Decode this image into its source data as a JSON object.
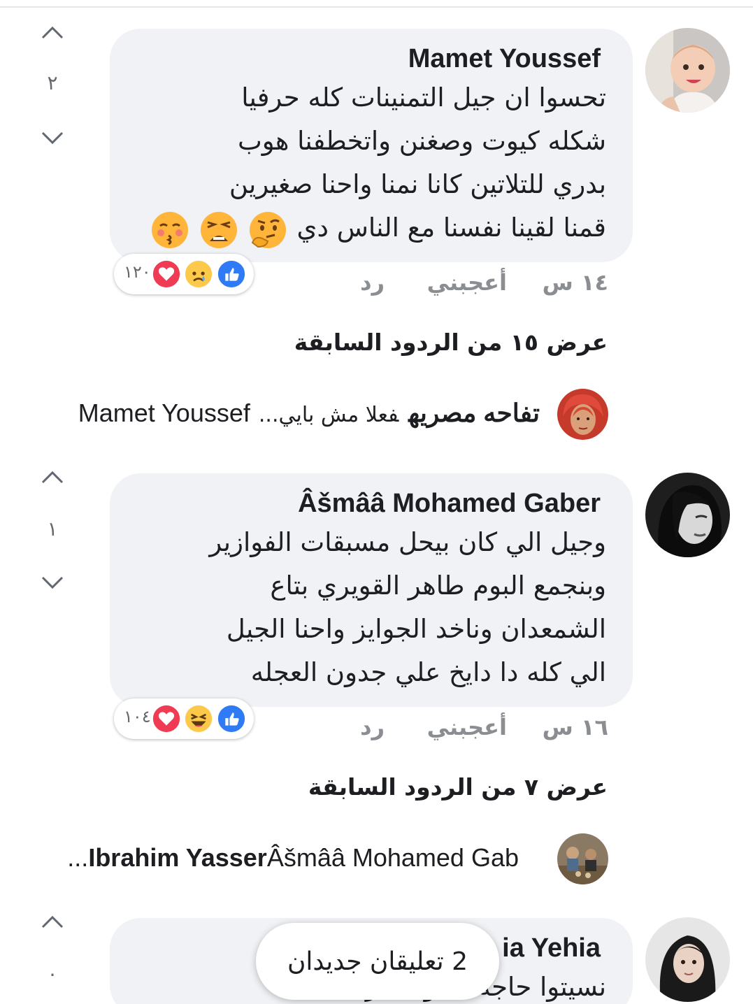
{
  "comments": [
    {
      "author": "Mamet Youssef",
      "lines": [
        "تحسوا ان جيل التمنينات كله حرفيا",
        "شكله كيوت وصغنن واتخطفنا هوب",
        "بدري للتلاتين كانا نمنا واحنا صغيرين",
        "قمنا لقينا نفسنا مع الناس دي"
      ],
      "emoji_icons": [
        "thinking-face",
        "weary-face",
        "kissing-face"
      ],
      "votes": "٢",
      "reactions": {
        "icons": [
          "like",
          "sad",
          "love"
        ],
        "count": "١٢٠"
      },
      "time": "١٤ س",
      "like_label": "أعجبني",
      "reply_label": "رد",
      "view_more": "عرض ١٥ من الردود السابقة",
      "reply_preview": {
        "author": "تفاحه مصريه",
        "text": "فعلا مش بايي...",
        "reply_to": "Mamet Youssef"
      }
    },
    {
      "author": "Âšmââ Mohamed Gaber",
      "lines": [
        "وجيل الي كان بيحل مسبقات الفوازير",
        "وبنجمع البوم طاهر القويري بتاع",
        "الشمعدان وناخد الجوايز واحنا الجيل",
        "الي كله دا دايخ علي جدون العجله"
      ],
      "votes": "١",
      "reactions": {
        "icons": [
          "like",
          "haha",
          "love"
        ],
        "count": "١٠٤"
      },
      "time": "١٦ س",
      "like_label": "أعجبني",
      "reply_label": "رد",
      "view_more": "عرض ٧ من الردود السابقة",
      "reply_preview": {
        "author": "Ibrahim Yasser",
        "reply_to": "Âšmââ Mohamed Gab..."
      }
    },
    {
      "author_visible": "ia Yehia",
      "line_visible": "نسيتوا حاجة ... وسمير",
      "votes": "٠"
    }
  ],
  "new_comments_toast": "2 تعليقان جديدان"
}
